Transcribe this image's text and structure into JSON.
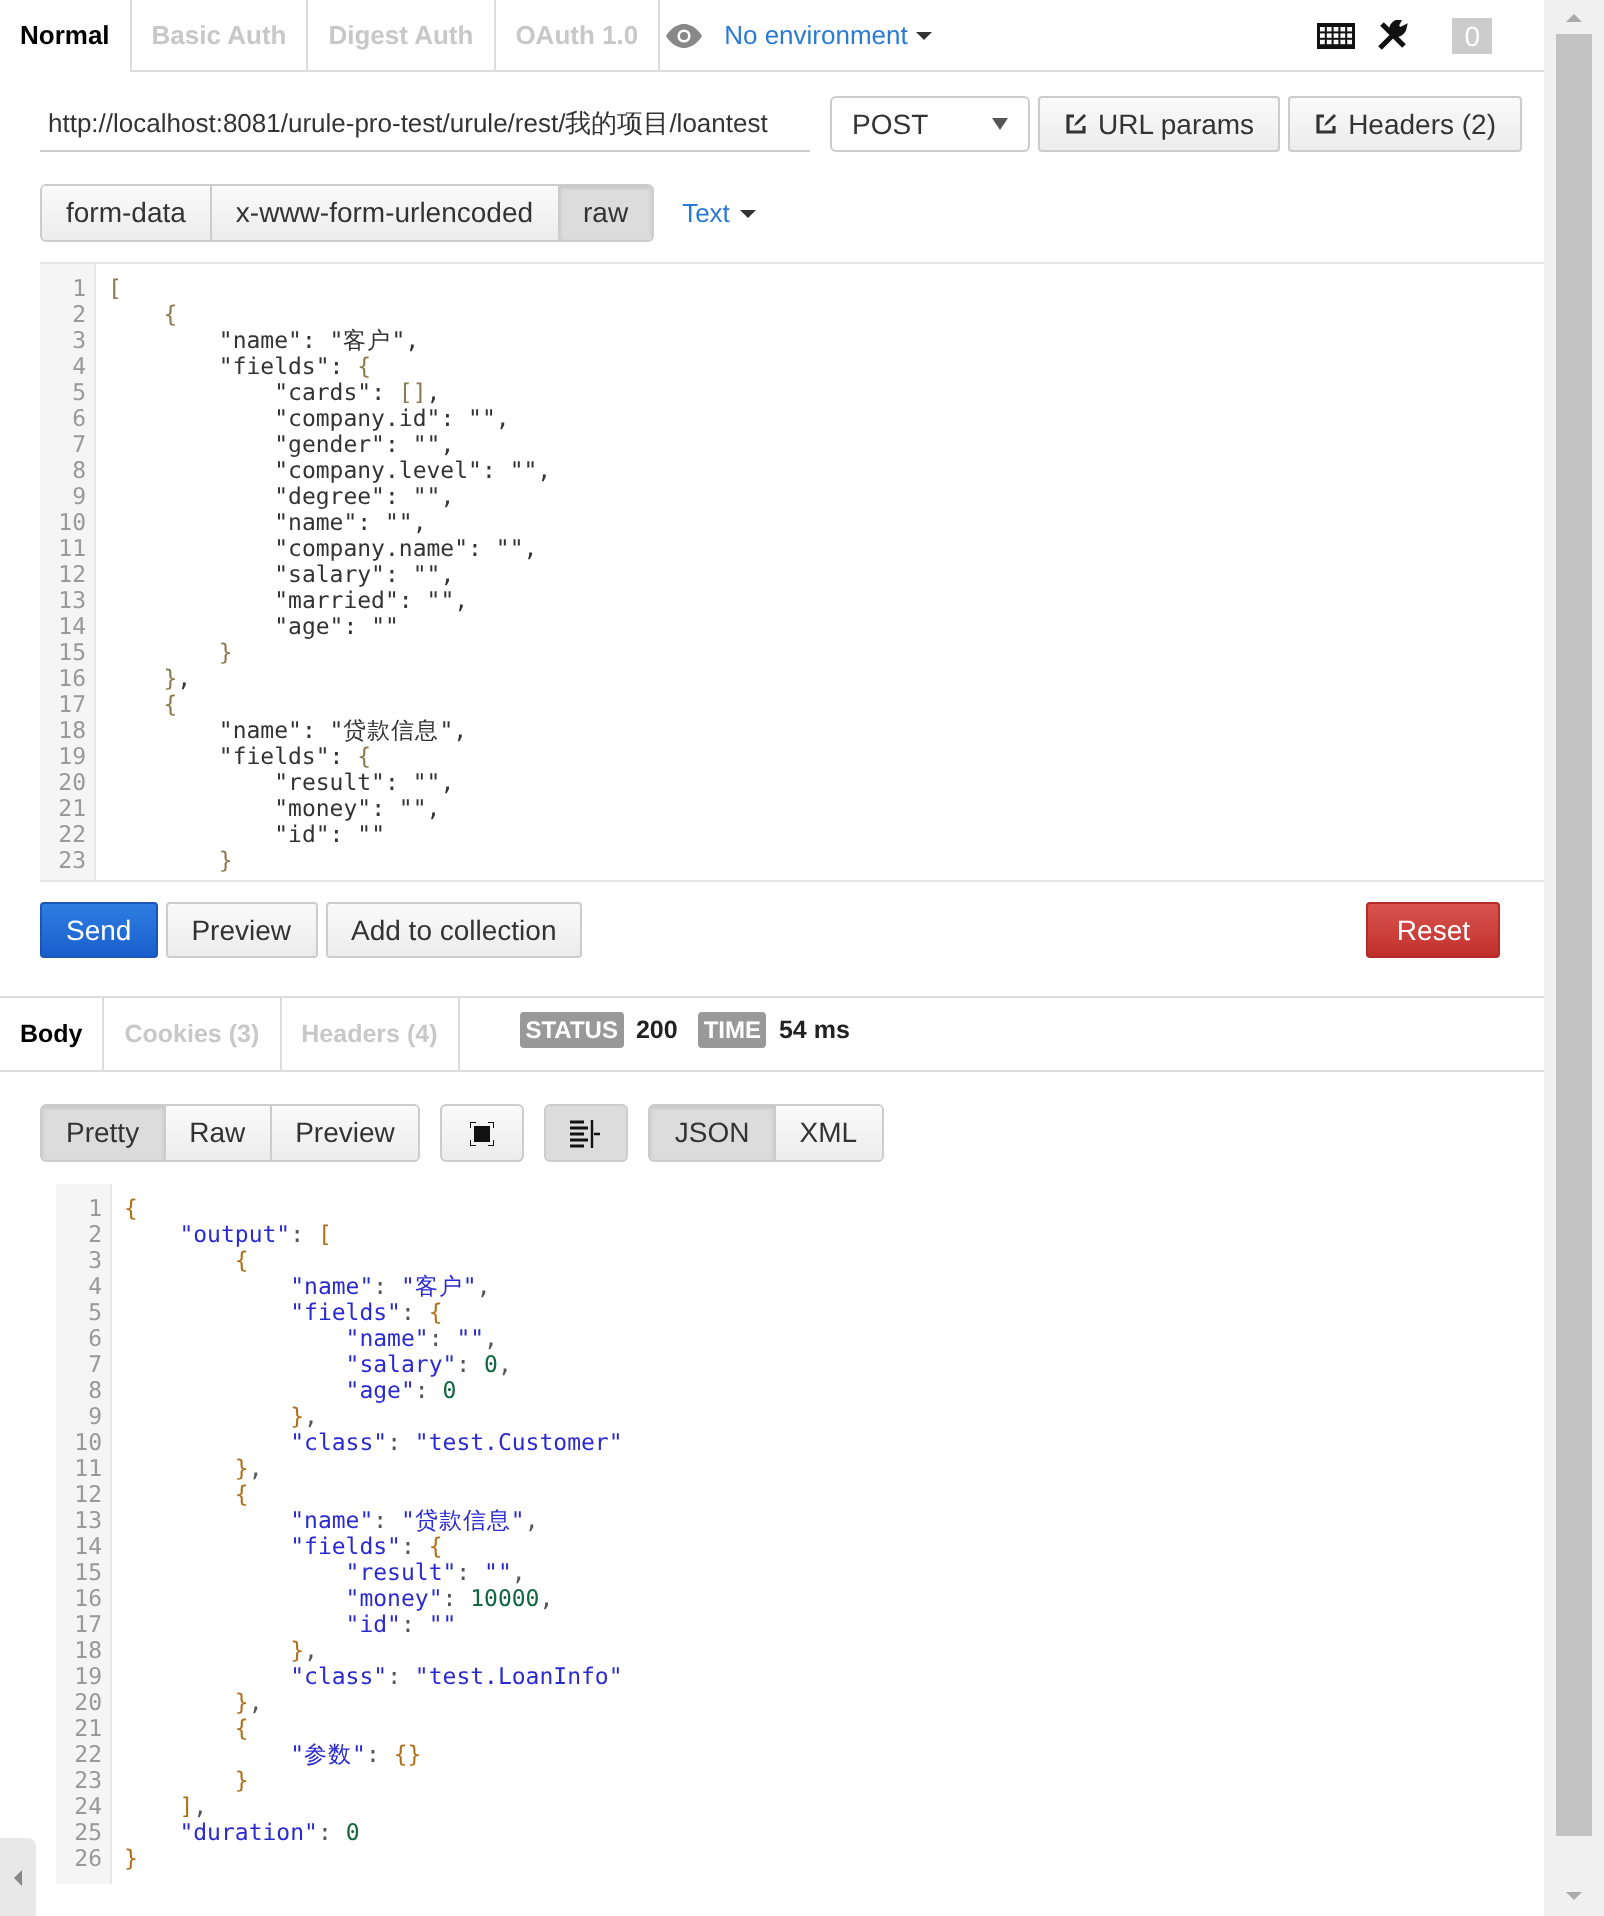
{
  "auth_tabs": [
    {
      "label": "Normal",
      "selected": true
    },
    {
      "label": "Basic Auth",
      "selected": false
    },
    {
      "label": "Digest Auth",
      "selected": false
    },
    {
      "label": "OAuth 1.0",
      "selected": false
    }
  ],
  "environment": "No environment",
  "notification_count": "0",
  "request": {
    "url": "http://localhost:8081/urule-pro-test/urule/rest/我的项目/loantest",
    "method": "POST",
    "buttons": [
      "URL params",
      "Headers (2)"
    ]
  },
  "body_modes": [
    {
      "label": "form-data",
      "selected": false
    },
    {
      "label": "x-www-form-urlencoded",
      "selected": false
    },
    {
      "label": "raw",
      "selected": true
    }
  ],
  "body_format": "Text",
  "request_body": [
    {
      "number": "1",
      "code": "["
    },
    {
      "number": "2",
      "code": "    {"
    },
    {
      "number": "3",
      "code": "        \"name\": \"客户\","
    },
    {
      "number": "4",
      "code": "        \"fields\": {"
    },
    {
      "number": "5",
      "code": "            \"cards\": [],"
    },
    {
      "number": "6",
      "code": "            \"company.id\": \"\","
    },
    {
      "number": "7",
      "code": "            \"gender\": \"\","
    },
    {
      "number": "8",
      "code": "            \"company.level\": \"\","
    },
    {
      "number": "9",
      "code": "            \"degree\": \"\","
    },
    {
      "number": "10",
      "code": "            \"name\": \"\","
    },
    {
      "number": "11",
      "code": "            \"company.name\": \"\","
    },
    {
      "number": "12",
      "code": "            \"salary\": \"\","
    },
    {
      "number": "13",
      "code": "            \"married\": \"\","
    },
    {
      "number": "14",
      "code": "            \"age\": \"\""
    },
    {
      "number": "15",
      "code": "        }"
    },
    {
      "number": "16",
      "code": "    },"
    },
    {
      "number": "17",
      "code": "    {"
    },
    {
      "number": "18",
      "code": "        \"name\": \"贷款信息\","
    },
    {
      "number": "19",
      "code": "        \"fields\": {"
    },
    {
      "number": "20",
      "code": "            \"result\": \"\","
    },
    {
      "number": "21",
      "code": "            \"money\": \"\","
    },
    {
      "number": "22",
      "code": "            \"id\": \"\""
    },
    {
      "number": "23",
      "code": "        }"
    }
  ],
  "actions": [
    {
      "label": "Send",
      "kind": "primary"
    },
    {
      "label": "Preview",
      "kind": "default"
    },
    {
      "label": "Add to collection",
      "kind": "default"
    },
    {
      "label": "Reset",
      "kind": "danger"
    }
  ],
  "response_tabs": [
    {
      "label": "Body",
      "selected": true
    },
    {
      "label": "Cookies (3)",
      "selected": false
    },
    {
      "label": "Headers (4)",
      "selected": false
    }
  ],
  "status": {
    "label": "STATUS",
    "value": "200"
  },
  "time": {
    "label": "TIME",
    "value": "54 ms"
  },
  "view_modes": [
    {
      "label": "Pretty",
      "selected": true
    },
    {
      "label": "Raw",
      "selected": false
    },
    {
      "label": "Preview",
      "selected": false
    }
  ],
  "formats": [
    {
      "label": "JSON",
      "selected": true
    },
    {
      "label": "XML",
      "selected": false
    }
  ],
  "response_body": [
    {
      "number": "1",
      "code": "{"
    },
    {
      "number": "2",
      "code": "    \"output\": ["
    },
    {
      "number": "3",
      "code": "        {"
    },
    {
      "number": "4",
      "code": "            \"name\": \"客户\","
    },
    {
      "number": "5",
      "code": "            \"fields\": {"
    },
    {
      "number": "6",
      "code": "                \"name\": \"\","
    },
    {
      "number": "7",
      "code": "                \"salary\": 0,"
    },
    {
      "number": "8",
      "code": "                \"age\": 0"
    },
    {
      "number": "9",
      "code": "            },"
    },
    {
      "number": "10",
      "code": "            \"class\": \"test.Customer\""
    },
    {
      "number": "11",
      "code": "        },"
    },
    {
      "number": "12",
      "code": "        {"
    },
    {
      "number": "13",
      "code": "            \"name\": \"贷款信息\","
    },
    {
      "number": "14",
      "code": "            \"fields\": {"
    },
    {
      "number": "15",
      "code": "                \"result\": \"\","
    },
    {
      "number": "16",
      "code": "                \"money\": 10000,"
    },
    {
      "number": "17",
      "code": "                \"id\": \"\""
    },
    {
      "number": "18",
      "code": "            },"
    },
    {
      "number": "19",
      "code": "            \"class\": \"test.LoanInfo\""
    },
    {
      "number": "20",
      "code": "        },"
    },
    {
      "number": "21",
      "code": "        {"
    },
    {
      "number": "22",
      "code": "            \"参数\": {}"
    },
    {
      "number": "23",
      "code": "        }"
    },
    {
      "number": "24",
      "code": "    ],"
    },
    {
      "number": "25",
      "code": "    \"duration\": 0"
    },
    {
      "number": "26",
      "code": "}"
    }
  ]
}
